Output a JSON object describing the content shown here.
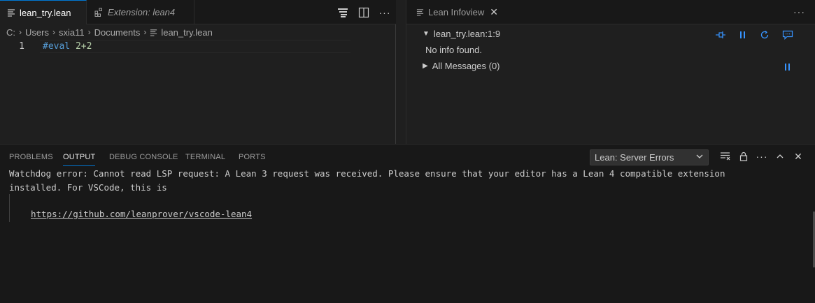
{
  "editor": {
    "tabs": [
      {
        "label": "lean_try.lean",
        "icon": "lines-icon",
        "dirty": true
      },
      {
        "label": "Extension: lean4",
        "icon": "extensions-icon"
      }
    ],
    "breadcrumb": [
      "C:",
      "Users",
      "sxia11",
      "Documents",
      "lean_try.lean"
    ],
    "lines": [
      {
        "number": "1",
        "keyword": "#eval",
        "rest": "2+2"
      }
    ]
  },
  "infoview": {
    "tab_label": "Lean Infoview",
    "goal_header": "lean_try.lean:1:9",
    "no_info": "No info found.",
    "all_messages": "All Messages (0)"
  },
  "panel": {
    "tabs": [
      "PROBLEMS",
      "OUTPUT",
      "DEBUG CONSOLE",
      "TERMINAL",
      "PORTS"
    ],
    "active_tab": "OUTPUT",
    "channel": "Lean: Server Errors",
    "output_text": "Watchdog error: Cannot read LSP request: A Lean 3 request was received. Please ensure that your editor has a Lean 4 compatible extension\ninstalled. For VSCode, this is",
    "output_link": "https://github.com/leanprover/vscode-lean4"
  },
  "colors": {
    "accent": "#0078d4",
    "link_blue": "#3794ff",
    "keyword": "#569cd6",
    "number": "#b5cea8"
  }
}
